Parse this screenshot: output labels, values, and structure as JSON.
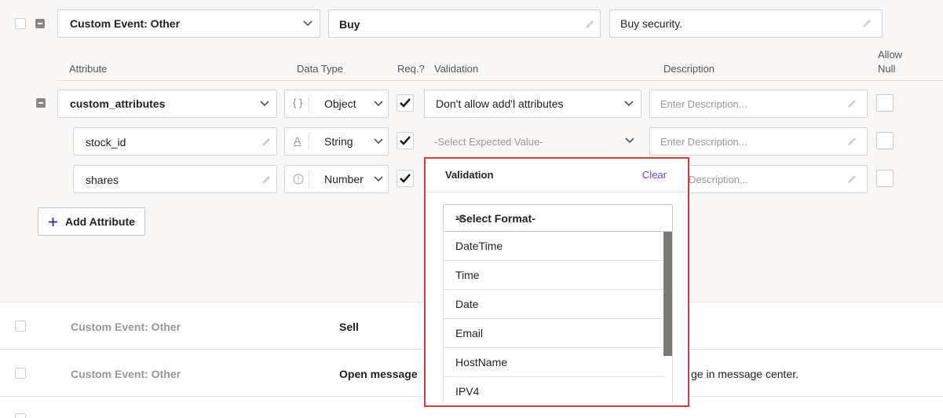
{
  "event": {
    "type_label": "Custom Event: Other",
    "name": "Buy",
    "description": "Buy security."
  },
  "headers": {
    "attribute": "Attribute",
    "data_type": "Data Type",
    "required": "Req.?",
    "validation": "Validation",
    "description": "Description",
    "allow_null_1": "Allow",
    "allow_null_2": "Null"
  },
  "attributes": [
    {
      "name": "custom_attributes",
      "type_icon": "{ }",
      "type": "Object",
      "required": true,
      "validation": "Don't allow add'l attributes",
      "description_placeholder": "Enter Description..."
    },
    {
      "name": "stock_id",
      "type_icon": "A",
      "type": "String",
      "required": true,
      "validation_placeholder": "-Select Expected Value-",
      "description_placeholder": "Enter Description..."
    },
    {
      "name": "shares",
      "type_icon": "clock",
      "type": "Number",
      "required": true,
      "description_placeholder": "Description..."
    }
  ],
  "add_attribute_label": "Add Attribute",
  "popup": {
    "title": "Validation",
    "clear_label": "Clear",
    "select_label": "-Select Format-",
    "options": [
      "DateTime",
      "Time",
      "Date",
      "Email",
      "HostName",
      "IPV4"
    ]
  },
  "other_events": [
    {
      "type_label": "Custom Event: Other",
      "name": "Sell",
      "description": ""
    },
    {
      "type_label": "Custom Event: Other",
      "name": "Open message",
      "description": "ge in message center."
    }
  ],
  "colors": {
    "accent": "#6a3fd1",
    "highlight_border": "#d93a3a",
    "panel_bg": "#f8f7f6"
  }
}
